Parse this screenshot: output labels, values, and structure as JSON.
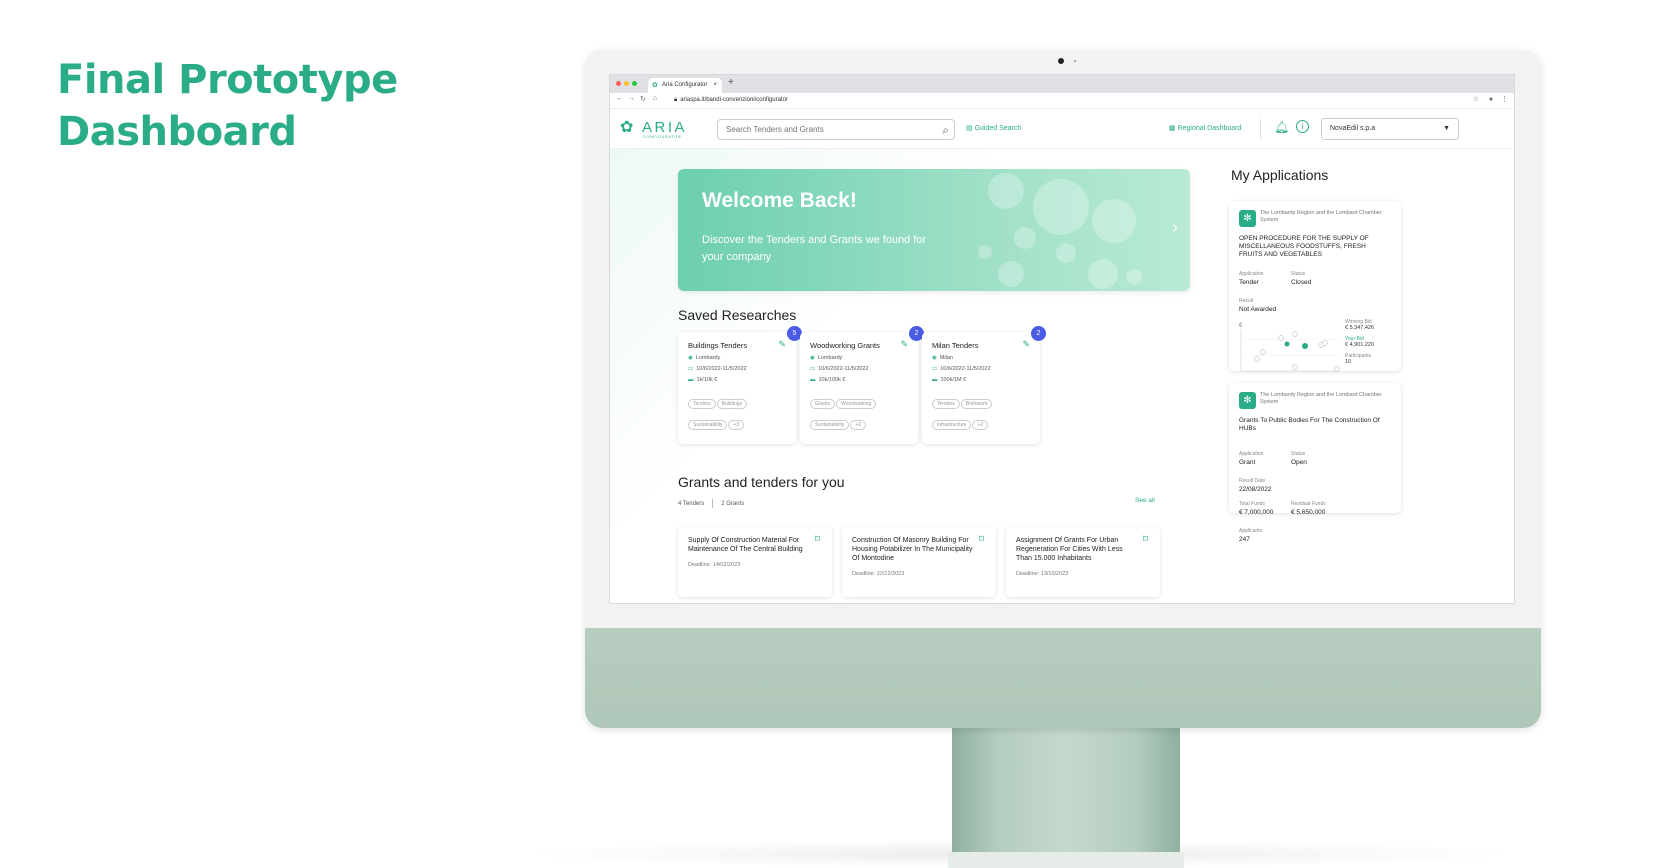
{
  "slide": {
    "title_line1": "Final Prototype",
    "title_line2": "Dashboard"
  },
  "browser": {
    "tab_title": "Aria Configurator",
    "tab_close": "×",
    "new_tab": "+",
    "url": "ariaspa.it/bandi-convenzioni/configurator"
  },
  "header": {
    "logo_word": "ARIA",
    "logo_sub": "CONFIGURATOR",
    "search_placeholder": "Search Tenders and Grants",
    "guided_search": "Guided Search",
    "regional_dashboard": "Regional Dashboard",
    "company": "NovaEdil s.p.a"
  },
  "welcome": {
    "title": "Welcome Back!",
    "subtitle": "Discover the Tenders and Grants we found for your company"
  },
  "saved": {
    "title": "Saved Researches",
    "cards": [
      {
        "name": "Buildings Tenders",
        "badge": "5",
        "location": "Lombardy",
        "dates": "10/6/2022-11/5/2022",
        "budget": "1k/10k €",
        "chips": [
          "Tenders",
          "Buildings",
          "Sustainability",
          "+3"
        ]
      },
      {
        "name": "Woodworking Grants",
        "badge": "2",
        "location": "Lombardy",
        "dates": "10/6/2022-11/5/2022",
        "budget": "10k/100k €",
        "chips": [
          "Grants",
          "Woodworking",
          "Sustainability",
          "+2"
        ]
      },
      {
        "name": "Milan Tenders",
        "badge": "2",
        "location": "Milan",
        "dates": "10/6/2022-11/5/2022",
        "budget": "100k/1M €",
        "chips": [
          "Tenders",
          "Brickwork",
          "Infrastructure",
          "+2"
        ]
      }
    ]
  },
  "grants": {
    "title": "Grants and tenders for you",
    "tab_tenders": "4 Tenders",
    "tab_grants": "2 Grants",
    "see_all": "See all",
    "cards": [
      {
        "title": "Supply Of Construction Material For Maintenance Of The Central Building",
        "deadline": "Deadline: 14/02/2023"
      },
      {
        "title": "Construction Of Masonry Building For Housing Potabilizer In The Municipality Of Montodine",
        "deadline": "Deadline: 22/12/2023"
      },
      {
        "title": "Assignment Of Grants For Urban Regeneration For Cities With Less Than 15.000 Inhabitants",
        "deadline": "Deadline: 13/10/2023"
      }
    ]
  },
  "applications": {
    "title": "My Applications",
    "card1": {
      "source": "The Lombardy Region and the Lombard Chamber System",
      "title": "OPEN PROCEDURE FOR THE SUPPLY OF MISCELLANEOUS FOODSTUFFS, FRESH FRUITS AND VEGETABLES",
      "application_label": "Application",
      "application": "Tender",
      "status_label": "Status",
      "status": "Closed",
      "result_label": "Result",
      "result": "Not Awarded",
      "chart_axis_label": "€",
      "winning_bid_label": "Winning Bid",
      "winning_bid": "€ 5,347,426",
      "your_bid_label": "Your Bid",
      "your_bid": "€ 4,901,220",
      "participants_label": "Participants",
      "participants": "10"
    },
    "card2": {
      "source": "The Lombardy Region and the Lombard Chamber System",
      "title": "Grants To Public Bodies For The Construction Of HUBs",
      "application_label": "Application",
      "application": "Grant",
      "status_label": "Status",
      "status": "Open",
      "result_date_label": "Result Date",
      "result_date": "22/08/2022",
      "total_funds_label": "Total Funds",
      "total_funds": "€ 7,000,000",
      "residual_funds_label": "Residual Funds",
      "residual_funds": "€ 5,650,000",
      "applicants_label": "Applicants",
      "applicants": "247"
    }
  },
  "colors": {
    "accent": "#2bac88",
    "badge": "#4a5ce6",
    "chin": "#b7cdbf"
  }
}
